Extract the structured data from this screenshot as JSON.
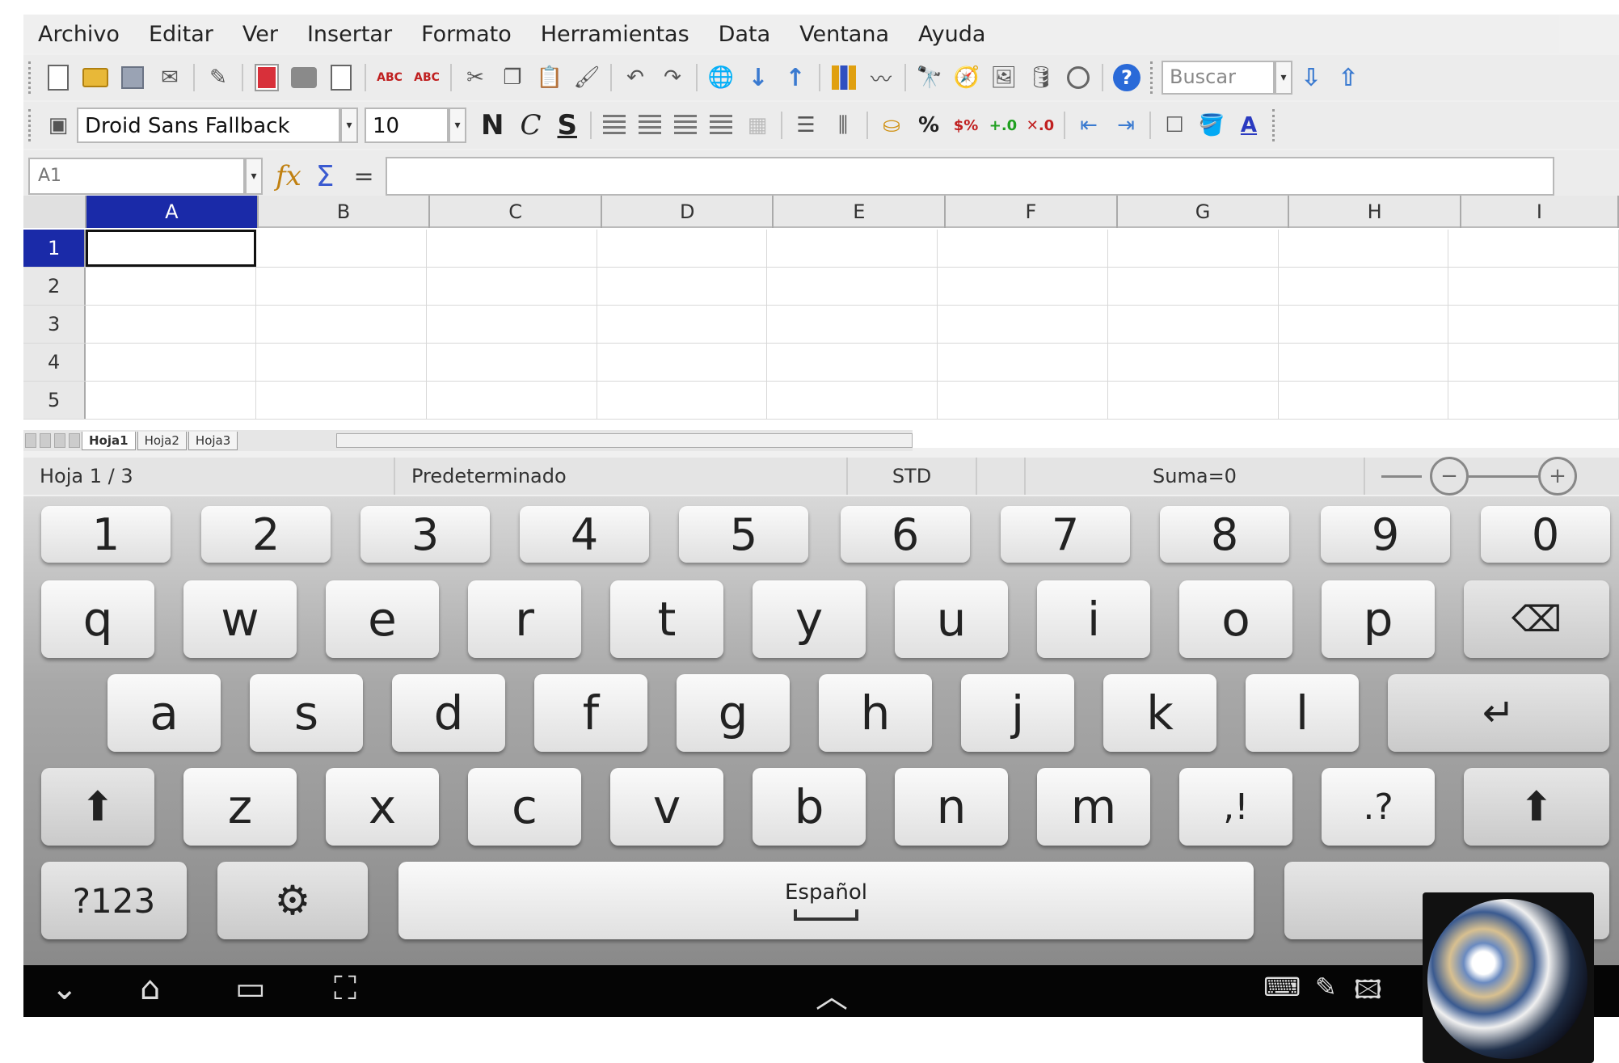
{
  "menu": [
    "Archivo",
    "Editar",
    "Ver",
    "Insertar",
    "Formato",
    "Herramientas",
    "Data",
    "Ventana",
    "Ayuda"
  ],
  "search": {
    "placeholder": "Buscar"
  },
  "font": {
    "name": "Droid Sans Fallback",
    "size": "10"
  },
  "format_buttons": {
    "bold": "N",
    "italic": "C",
    "underline": "S"
  },
  "formula": {
    "cell_ref": "A1",
    "fx_label": "fx",
    "sum_label": "Σ",
    "equals_label": "="
  },
  "columns": [
    "A",
    "B",
    "C",
    "D",
    "E",
    "F",
    "G",
    "H",
    "I"
  ],
  "rows": [
    "1",
    "2",
    "3",
    "4",
    "5"
  ],
  "sheets": [
    "Hoja1",
    "Hoja2",
    "Hoja3"
  ],
  "status": {
    "sheet": "Hoja 1 / 3",
    "style": "Predeterminado",
    "mode": "STD",
    "sum": "Suma=0"
  },
  "keyboard": {
    "numbers": [
      "1",
      "2",
      "3",
      "4",
      "5",
      "6",
      "7",
      "8",
      "9",
      "0"
    ],
    "row1": [
      "q",
      "w",
      "e",
      "r",
      "t",
      "y",
      "u",
      "i",
      "o",
      "p"
    ],
    "row2": [
      "a",
      "s",
      "d",
      "f",
      "g",
      "h",
      "j",
      "k",
      "l"
    ],
    "row3": [
      "z",
      "x",
      "c",
      "v",
      "b",
      "n",
      "m"
    ],
    "punct1": ",!",
    "punct2": ".?",
    "symbols_label": "?123",
    "space_label": "Español"
  },
  "icons": [
    "new-doc-icon",
    "open-folder-icon",
    "save-icon",
    "email-icon",
    "pdf-icon",
    "print-icon",
    "spellcheck-icon",
    "cut-icon",
    "copy-icon",
    "paste-icon",
    "undo-icon",
    "redo-icon",
    "chart-icon",
    "find-icon",
    "help-icon",
    "backspace-icon",
    "enter-icon",
    "shift-icon",
    "gear-icon",
    "back-icon",
    "home-icon",
    "recent-apps-icon",
    "screenshot-icon"
  ]
}
